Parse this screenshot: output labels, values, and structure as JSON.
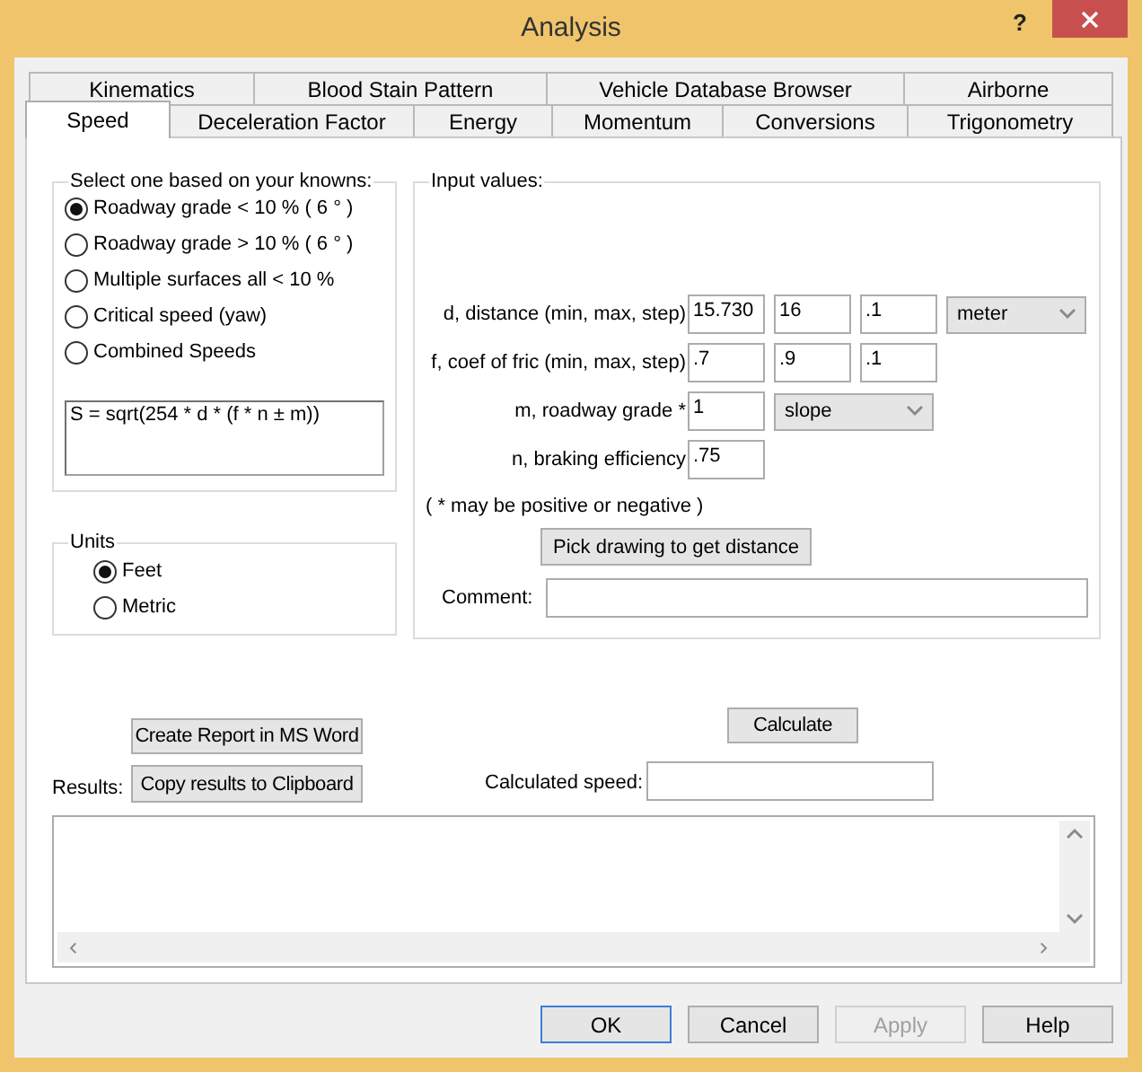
{
  "window": {
    "title": "Analysis",
    "help_glyph": "?"
  },
  "tab_rows": [
    [
      {
        "label": "Kinematics",
        "selected": false
      },
      {
        "label": "Blood Stain Pattern",
        "selected": false
      },
      {
        "label": "Vehicle Database Browser",
        "selected": false
      },
      {
        "label": "Airborne",
        "selected": false
      }
    ],
    [
      {
        "label": "Speed",
        "selected": true
      },
      {
        "label": "Deceleration Factor",
        "selected": false
      },
      {
        "label": "Energy",
        "selected": false
      },
      {
        "label": "Momentum",
        "selected": false
      },
      {
        "label": "Conversions",
        "selected": false
      },
      {
        "label": "Trigonometry",
        "selected": false
      }
    ]
  ],
  "method_group": {
    "title": "Select one based on your knowns:",
    "options": [
      {
        "label": "Roadway grade < 10 % ( 6 ° )",
        "selected": true
      },
      {
        "label": "Roadway grade > 10 % ( 6 ° )",
        "selected": false
      },
      {
        "label": "Multiple surfaces all < 10 %",
        "selected": false
      },
      {
        "label": "Critical speed (yaw)",
        "selected": false
      },
      {
        "label": "Combined Speeds",
        "selected": false
      }
    ],
    "formula": "S = sqrt(254 * d * (f * n ± m))"
  },
  "units_group": {
    "title": "Units",
    "options": [
      {
        "label": "Feet",
        "selected": true
      },
      {
        "label": "Metric",
        "selected": false
      }
    ]
  },
  "inputs_group": {
    "title": "Input values:",
    "rows": [
      {
        "label": "d, distance (min, max, step)",
        "values": [
          "15.730",
          "16",
          ".1"
        ],
        "dropdown": "meter"
      },
      {
        "label": "f, coef of fric (min, max, step)",
        "values": [
          ".7",
          ".9",
          ".1"
        ]
      },
      {
        "label": "m, roadway grade *",
        "values": [
          "1"
        ],
        "dropdown": "slope"
      },
      {
        "label": "n, braking efficiency",
        "values": [
          ".75"
        ]
      }
    ],
    "note": "( * may be positive or negative )",
    "pick_button": "Pick drawing to get distance",
    "comment_label": "Comment:"
  },
  "results": {
    "report_button": "Create Report in MS Word",
    "calculate_button": "Calculate",
    "label": "Results:",
    "copy_button": "Copy results to Clipboard",
    "speed_label": "Calculated speed:"
  },
  "footer_buttons": [
    {
      "label": "OK",
      "disabled": false,
      "focused": true
    },
    {
      "label": "Cancel",
      "disabled": false,
      "focused": false
    },
    {
      "label": "Apply",
      "disabled": true,
      "focused": false
    },
    {
      "label": "Help",
      "disabled": false,
      "focused": false
    }
  ]
}
